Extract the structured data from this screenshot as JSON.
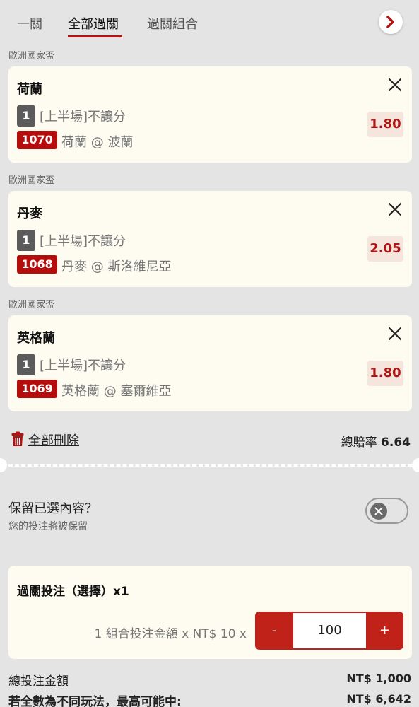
{
  "tabs": [
    {
      "label": "一關",
      "active": false
    },
    {
      "label": "全部過關",
      "active": true
    },
    {
      "label": "過關組合",
      "active": false
    }
  ],
  "icons": {
    "next": "chevron-right-icon",
    "close": "close-icon",
    "delete": "trash-icon",
    "toggle": "x-circle-icon"
  },
  "selections": [
    {
      "league": "歐洲國家盃",
      "team": "荷蘭",
      "num": "1",
      "market": "[上半場]不讓分",
      "code": "1070",
      "match": "荷蘭 @ 波蘭",
      "odds": "1.80"
    },
    {
      "league": "歐洲國家盃",
      "team": "丹麥",
      "num": "1",
      "market": "[上半場]不讓分",
      "code": "1068",
      "match": "丹麥 @ 斯洛維尼亞",
      "odds": "2.05"
    },
    {
      "league": "歐洲國家盃",
      "team": "英格蘭",
      "num": "1",
      "market": "[上半場]不讓分",
      "code": "1069",
      "match": "英格蘭 @ 塞爾維亞",
      "odds": "1.80"
    }
  ],
  "actions": {
    "delete_all": "全部刪除",
    "total_odds_label": "總賠率",
    "total_odds_value": "6.64"
  },
  "keep": {
    "title": "保留已選內容？",
    "subtitle": "您的投注將被保留",
    "enabled": false
  },
  "parlay": {
    "title": "過關投注（選擇）x1",
    "combo_label": "1 組合投注金額 x NT$ 10 x",
    "minus": "-",
    "amount": "100",
    "plus": "+"
  },
  "summary": {
    "total_stake_label": "總投注金額",
    "total_stake_value": "NT$ 1,000",
    "max_win_label": "若全數為不同玩法，最高可能中:",
    "max_win_value": "NT$ 6,642"
  },
  "colors": {
    "accent": "#b51212",
    "card_bg": "#fefcf1",
    "page_bg": "#e4e4e4",
    "badge_grey": "#5b5b5b"
  }
}
